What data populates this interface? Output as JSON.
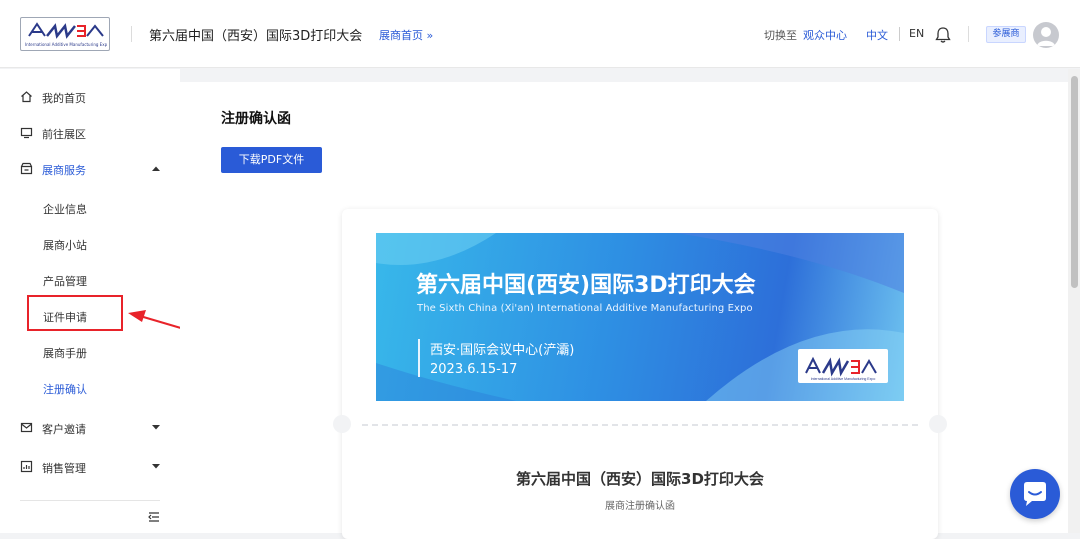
{
  "header": {
    "logo_text": "International Additive Manufacturing Expo",
    "app_title": "第六届中国（西安）国际3D打印大会",
    "home_link": "展商首页 »",
    "switch_label": "切换至",
    "switch_link": "观众中心",
    "lang_zh": "中文",
    "lang_en": "EN",
    "role_badge": "参展商"
  },
  "sidebar": {
    "items": [
      {
        "label": "我的首页",
        "icon": "home-icon"
      },
      {
        "label": "前往展区",
        "icon": "monitor-icon"
      },
      {
        "label": "展商服务",
        "icon": "store-icon",
        "expanded": true
      },
      {
        "label": "客户邀请",
        "icon": "mail-icon"
      },
      {
        "label": "销售管理",
        "icon": "chart-icon"
      }
    ],
    "sub_items": [
      {
        "label": "企业信息"
      },
      {
        "label": "展商小站"
      },
      {
        "label": "产品管理"
      },
      {
        "label": "证件申请"
      },
      {
        "label": "展商手册"
      },
      {
        "label": "注册确认"
      }
    ]
  },
  "main": {
    "title": "注册确认函",
    "download_button": "下载PDF文件",
    "banner": {
      "title": "第六届中国(西安)国际3D打印大会",
      "subtitle": "The Sixth China (Xi'an) International Additive Manufacturing Expo",
      "venue": "西安·国际会议中心(浐灞)",
      "date": "2023.6.15-17",
      "logo_text": "International Additive Manufacturing Expo"
    },
    "card_title": "第六届中国（西安）国际3D打印大会",
    "card_subtitle": "展商注册确认函"
  },
  "colors": {
    "accent": "#2a5bd7",
    "highlight": "#e8232a",
    "banner_start": "#38b8ea",
    "banner_end": "#2d6fd9"
  }
}
